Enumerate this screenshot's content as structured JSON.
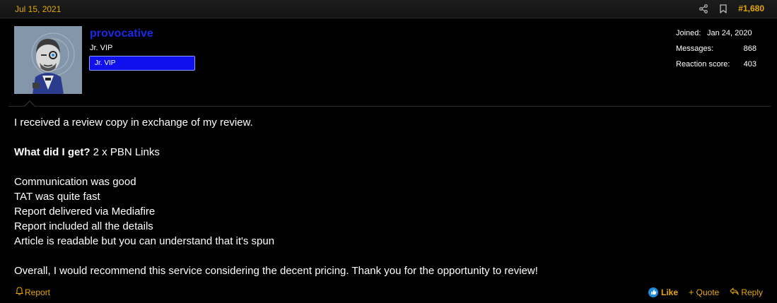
{
  "post": {
    "date": "Jul 15, 2021",
    "number": "#1,680"
  },
  "user": {
    "name": "provocative",
    "title": "Jr. VIP",
    "banner": "Jr. VIP",
    "extras": {
      "joined_label": "Joined:",
      "joined_value": "Jan 24, 2020",
      "messages_label": "Messages:",
      "messages_value": "868",
      "reaction_label": "Reaction score:",
      "reaction_value": "403"
    }
  },
  "message": {
    "line1": "I received a review copy in exchange of my review.",
    "question_bold": "What did I get?",
    "question_rest": " 2 x PBN Links",
    "line3": "Communication was good",
    "line4": "TAT was quite fast",
    "line5": "Report delivered via Mediafire",
    "line6": "Report included all the details",
    "line7": "Article is readable but you can understand that it's spun",
    "line8": "Overall, I would recommend this service considering the decent pricing. Thank you for the opportunity to review!"
  },
  "footer": {
    "report_label": "Report",
    "like_label": "Like",
    "quote_label": "Quote",
    "reply_label": "Reply"
  },
  "colors": {
    "accent": "#e6a800",
    "username": "#1a2be6",
    "banner_bg": "#1010ee",
    "like_icon": "#1e8ad8"
  },
  "icons": {
    "share": "share-icon",
    "bookmark": "bookmark-icon",
    "report": "bell-icon",
    "like": "thumbs-up-icon",
    "quote": "plus-icon",
    "reply": "reply-arrow-icon"
  }
}
